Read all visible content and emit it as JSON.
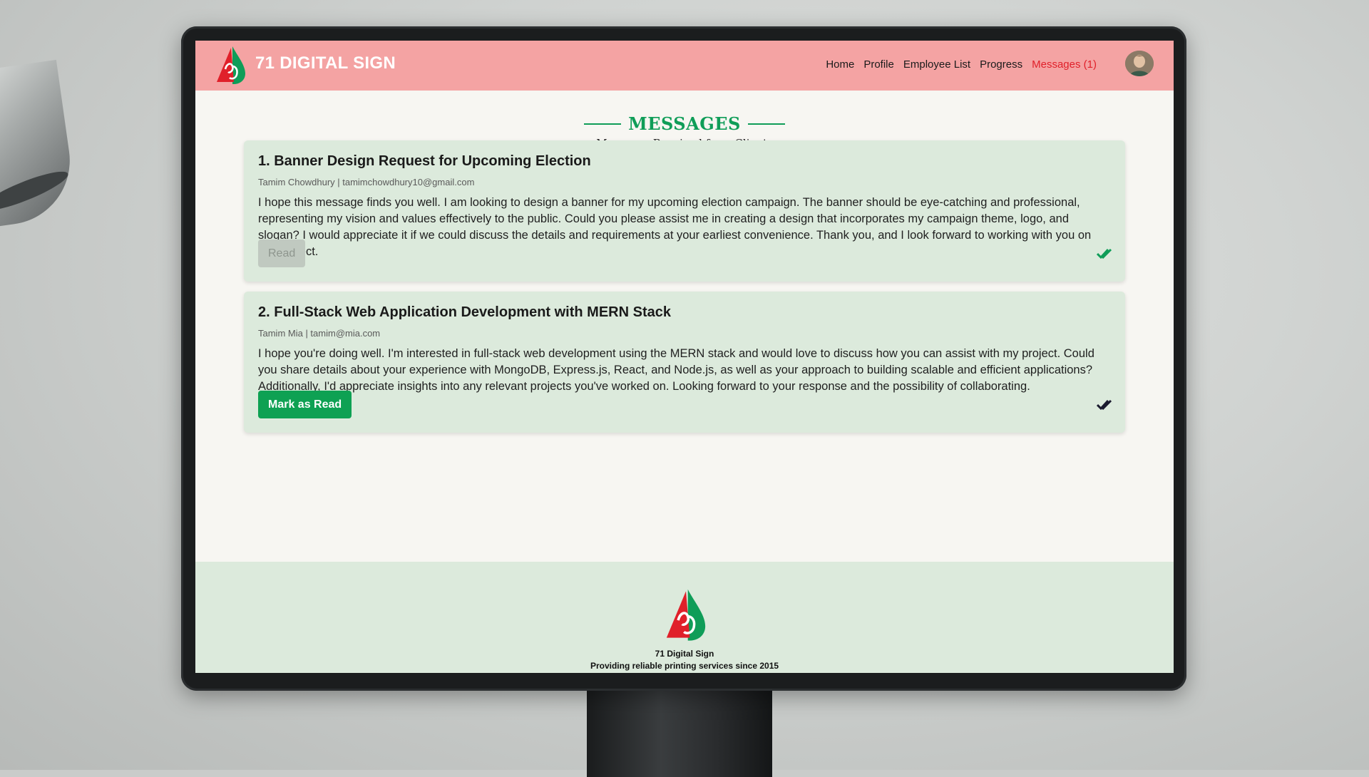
{
  "nav": {
    "brand": "71 DIGITAL SIGN",
    "links": [
      "Home",
      "Profile",
      "Employee List",
      "Progress",
      "Messages (1)"
    ]
  },
  "page": {
    "title": "MESSAGES",
    "subtitle": "Messages Received from Clients"
  },
  "messages": [
    {
      "title": "1. Banner Design Request for Upcoming Election",
      "meta": "Tamim Chowdhury | tamimchowdhury10@gmail.com",
      "body": "I hope this message finds you well. I am looking to design a banner for my upcoming election campaign. The banner should be eye-catching and professional, representing my vision and values effectively to the public. Could you please assist me in creating a design that incorporates my campaign theme, logo, and slogan? I would appreciate it if we could discuss the details and requirements at your earliest convenience. Thank you, and I look forward to working with you on this project.",
      "button": "Read",
      "status_icon": "double-check-icon",
      "status_color": "#0f9d58"
    },
    {
      "title": "2. Full-Stack Web Application Development with MERN Stack",
      "meta": "Tamim Mia | tamim@mia.com",
      "body": "I hope you're doing well. I'm interested in full-stack web development using the MERN stack and would love to discuss how you can assist with my project. Could you share details about your experience with MongoDB, Express.js, React, and Node.js, as well as your approach to building scalable and efficient applications? Additionally, I'd appreciate insights into any relevant projects you've worked on. Looking forward to your response and the possibility of collaborating.",
      "button": "Mark as Read",
      "status_icon": "double-check-icon",
      "status_color": "#1a1a2e"
    }
  ],
  "footer": {
    "name": "71 Digital Sign",
    "tagline": "Providing reliable printing services since 2015"
  },
  "colors": {
    "navbar": "#f4a3a3",
    "accent": "#0f9d58",
    "active_link": "#e0202a",
    "card_bg": "#dceadc"
  }
}
